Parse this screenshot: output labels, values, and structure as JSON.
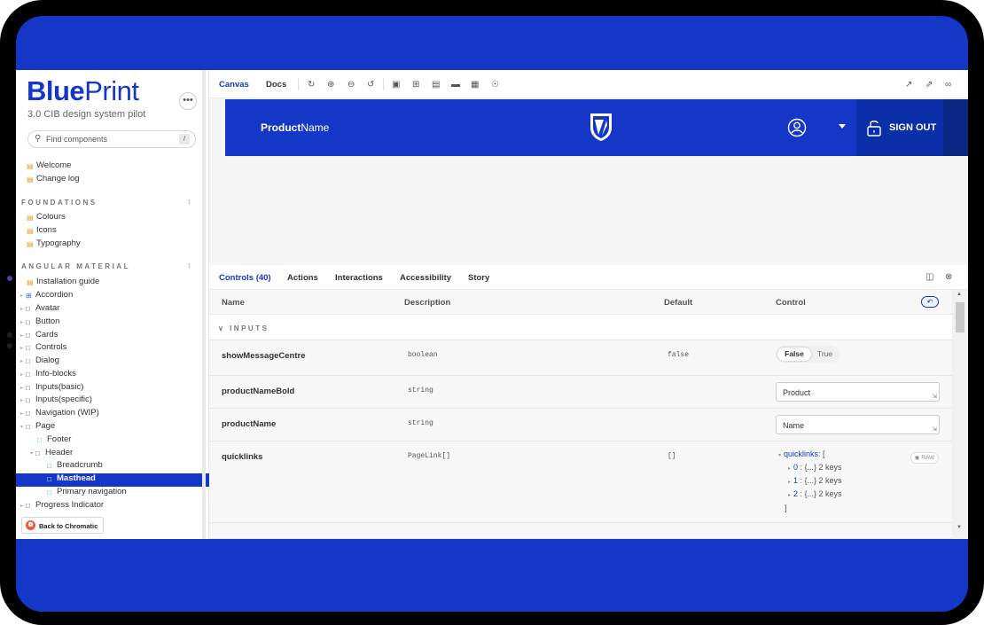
{
  "sidebar": {
    "logo_bold": "Blue",
    "logo_light": "Print",
    "subtitle": "3.0 CIB design system pilot",
    "more_label": "•••",
    "search_placeholder": "Find components",
    "search_shortcut": "/",
    "top_items": [
      "Welcome",
      "Change log"
    ],
    "foundations": {
      "heading": "FOUNDATIONS",
      "items": [
        "Colours",
        "Icons",
        "Typography"
      ]
    },
    "angular": {
      "heading": "ANGULAR MATERIAL",
      "items": [
        {
          "label": "Installation guide"
        },
        {
          "label": "Accordion"
        },
        {
          "label": "Avatar"
        },
        {
          "label": "Button"
        },
        {
          "label": "Cards"
        },
        {
          "label": "Controls"
        },
        {
          "label": "Dialog"
        },
        {
          "label": "Info-blocks"
        },
        {
          "label": "Inputs(basic)"
        },
        {
          "label": "Inputs(specific)"
        },
        {
          "label": "Navigation (WIP)"
        },
        {
          "label": "Page"
        },
        {
          "label": "Footer"
        },
        {
          "label": "Header"
        },
        {
          "label": "Breadcrumb"
        },
        {
          "label": "Masthead"
        },
        {
          "label": "Primary navigation"
        },
        {
          "label": "Progress Indicator"
        }
      ]
    },
    "back_chromatic": "Back to Chromatic"
  },
  "toolbar": {
    "tabs": [
      "Canvas",
      "Docs"
    ],
    "active_tab": "Canvas"
  },
  "masthead": {
    "product_bold": "Product",
    "product_light": "Name",
    "signout_label": "SIGN OUT",
    "brand_color": "#1437c8"
  },
  "addons": {
    "tabs": [
      "Controls (40)",
      "Actions",
      "Interactions",
      "Accessibility",
      "Story"
    ],
    "columns": [
      "Name",
      "Description",
      "Default",
      "Control"
    ],
    "section": "INPUTS",
    "rows": [
      {
        "name": "showMessageCentre",
        "description": "boolean",
        "default": "false",
        "toggle_false": "False",
        "toggle_true": "True"
      },
      {
        "name": "productNameBold",
        "description": "string",
        "default": "",
        "value": "Product"
      },
      {
        "name": "productName",
        "description": "string",
        "default": "",
        "value": "Name"
      },
      {
        "name": "quicklinks",
        "description": "PageLink[]",
        "default": "[]",
        "raw_label": "RAW",
        "json": {
          "key": "quicklinks",
          "open": ": [",
          "entries": [
            {
              "idx": "0",
              "val": " : {...} 2 keys"
            },
            {
              "idx": "1",
              "val": " : {...} 2 keys"
            },
            {
              "idx": "2",
              "val": " : {...} 2 keys"
            }
          ],
          "close": "]"
        }
      }
    ]
  }
}
